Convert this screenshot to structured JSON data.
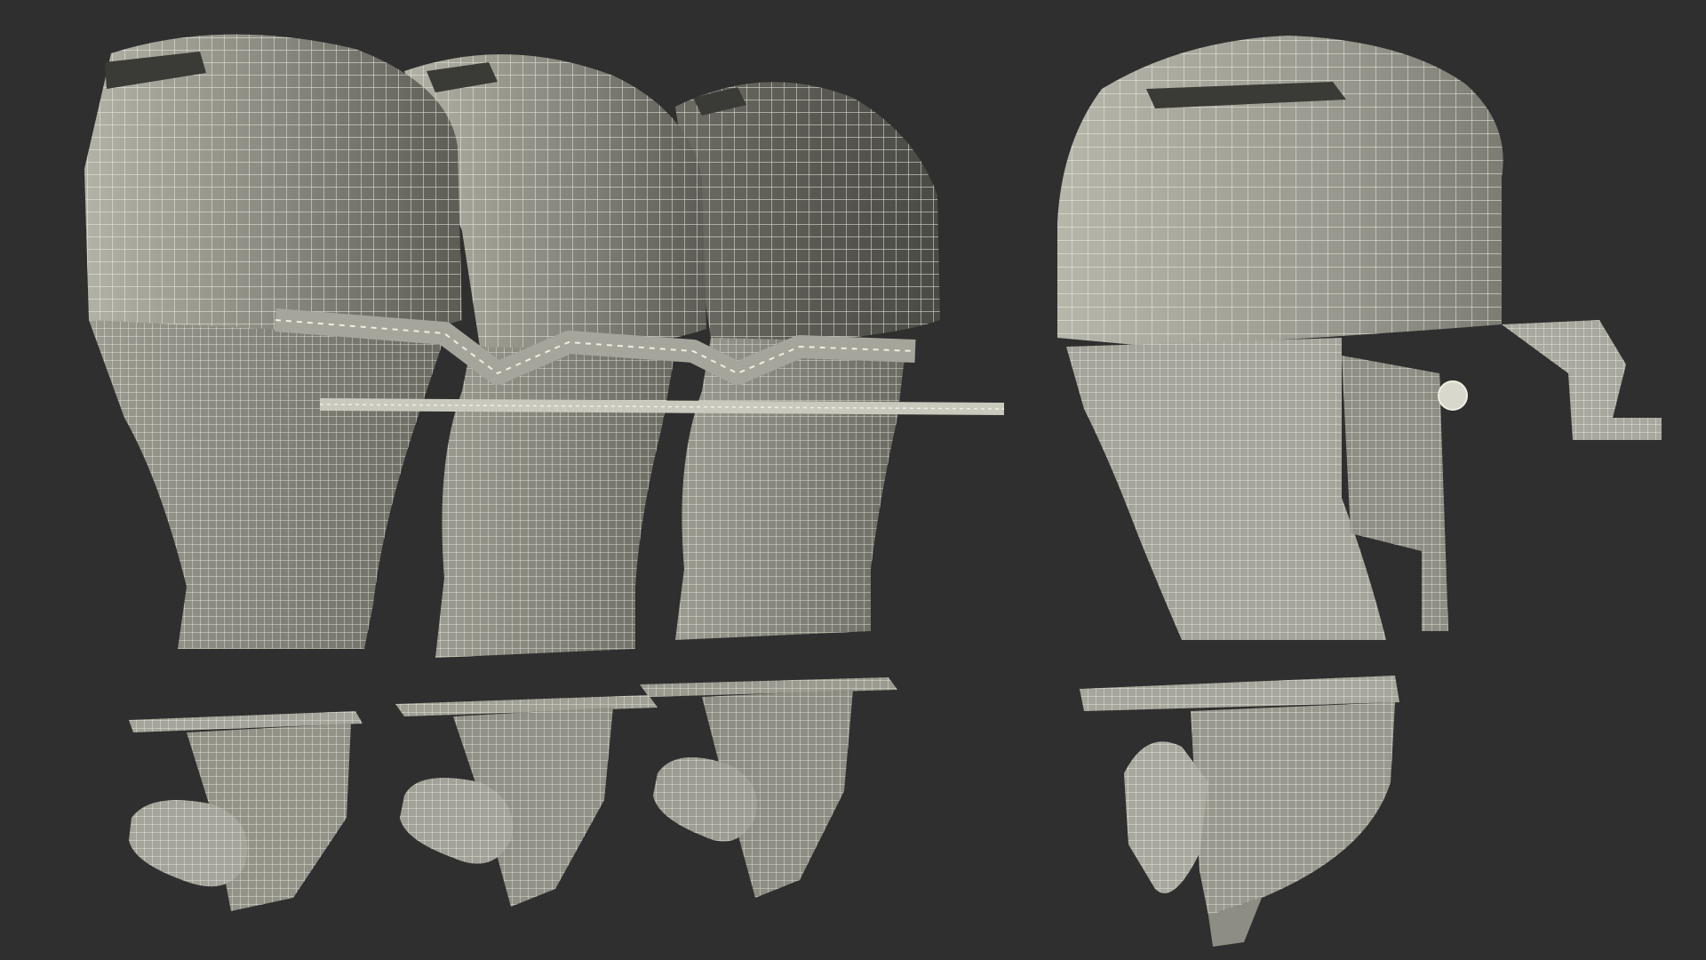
{
  "scene": {
    "background": "#2f2f2f",
    "wire_color": "#efeee3",
    "shell_light": "#a6a69b",
    "shell_mid": "#85857b",
    "shell_dark": "#55554e",
    "objects": [
      {
        "id": "engine-1",
        "kind": "outboard-motor-wireframe",
        "view": "three-quarter"
      },
      {
        "id": "engine-2",
        "kind": "outboard-motor-wireframe",
        "view": "three-quarter"
      },
      {
        "id": "engine-3",
        "kind": "outboard-motor-wireframe",
        "view": "three-quarter"
      },
      {
        "id": "engine-side",
        "kind": "outboard-motor-wireframe",
        "view": "side"
      }
    ]
  }
}
